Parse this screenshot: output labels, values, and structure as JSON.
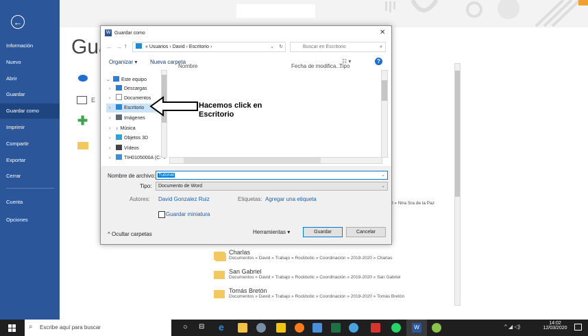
{
  "sidebar": {
    "items": [
      "Información",
      "Nuevo",
      "Abrir",
      "Guardar",
      "Guardar como",
      "Imprimir",
      "Compartir",
      "Exportar",
      "Cerrar"
    ],
    "bottom_items": [
      "Cuenta",
      "Opciones"
    ]
  },
  "main": {
    "title": "Gua",
    "location_hint": "E",
    "recent_partial_path": "0 » Ntra Sra de la Paz",
    "recent_folders": [
      {
        "name": "Charlas",
        "path": "Documentos » David » Trabajo » Rockbotic » Coordinación » 2019-2020 » Charlas"
      },
      {
        "name": "San Gabriel",
        "path": "Documentos » David » Trabajo » Rockbotic » Coordinación » 2019-2020 » San Gabriel"
      },
      {
        "name": "Tomás Bretón",
        "path": "Documentos » David » Trabajo » Rockbotic » Coordinación » 2019-2020 » Tomás Bretón"
      }
    ]
  },
  "dialog": {
    "title": "Guardar como",
    "breadcrumb": [
      "«",
      "Usuarios",
      "›",
      "David",
      "›",
      "Escritorio",
      "›"
    ],
    "search_placeholder": "Buscar en Escritorio",
    "toolbar": {
      "organize": "Organizar ▾",
      "new_folder": "Nueva carpeta"
    },
    "columns": {
      "name": "Nombre",
      "date": "Fecha de modifica...",
      "type": "Tipo"
    },
    "nav": [
      {
        "label": "Este equipo",
        "color": "#2d7fd3",
        "arrow": "⌄"
      },
      {
        "label": "Descargas",
        "color": "#2d7fd3",
        "arrow": "›"
      },
      {
        "label": "Documentos",
        "color": "#8a8a8a",
        "arrow": "›"
      },
      {
        "label": "Escritorio",
        "color": "#1f8ad9",
        "arrow": "›",
        "selected": true
      },
      {
        "label": "Imágenes",
        "color": "#5b6b7b",
        "arrow": "›"
      },
      {
        "label": "Música",
        "color": "#1d64c4",
        "arrow": "›"
      },
      {
        "label": "Objetos 3D",
        "color": "#29a3d8",
        "arrow": "›"
      },
      {
        "label": "Vídeos",
        "color": "#444444",
        "arrow": "›"
      },
      {
        "label": "TIH0105000A (C:",
        "color": "#3c8fd8",
        "arrow": "›"
      }
    ],
    "filename_label": "Nombre de archivo:",
    "filename_value": "Tutorial",
    "type_label": "Tipo:",
    "type_value": "Documento de Word",
    "authors_label": "Autores:",
    "authors_value": "David Gonzalez Ruiz",
    "tags_label": "Etiquetas:",
    "tags_value": "Agregar una etiqueta",
    "thumbnail_label": "Guardar miniatura",
    "hide_folders": "Ocultar carpetas",
    "tools": "Herramientas",
    "save": "Guardar",
    "cancel": "Cancelar"
  },
  "annotation": {
    "line1": "Hacemos click en",
    "line2": "Escritorio"
  },
  "taskbar": {
    "search_placeholder": "Escribe aquí para buscar",
    "time": "14:02",
    "date": "12/03/2020"
  }
}
